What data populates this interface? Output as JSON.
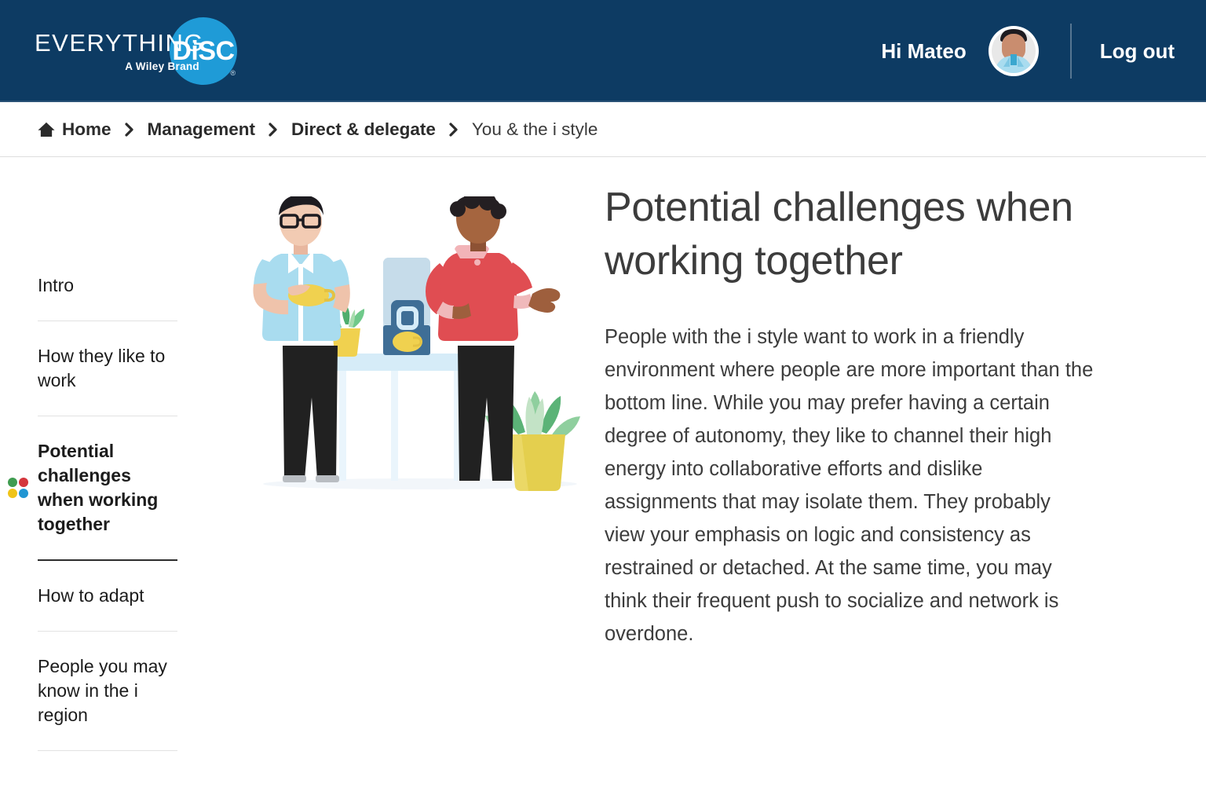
{
  "header": {
    "logo": {
      "wordmark": "EVERYTHING",
      "brand": "A Wiley Brand",
      "disc": "DiSC",
      "registered": "®"
    },
    "greeting": "Hi Mateo",
    "avatar_name": "user-avatar",
    "logout_label": "Log out",
    "background_color": "#0d3b63",
    "accent_color": "#1f9bd7"
  },
  "breadcrumb": {
    "home_label": "Home",
    "separator": "›",
    "items": [
      {
        "label": "Management",
        "current": false
      },
      {
        "label": "Direct & delegate",
        "current": false
      },
      {
        "label": "You & the i style",
        "current": true
      }
    ]
  },
  "sidebar": {
    "items": [
      {
        "label": "Intro",
        "active": false
      },
      {
        "label": "How they like to work",
        "active": false
      },
      {
        "label": "Potential challenges when working together",
        "active": true
      },
      {
        "label": "How to adapt",
        "active": false
      },
      {
        "label": "People you may know in the i region",
        "active": false
      }
    ],
    "active_marker_colors": {
      "top_left": "#3f9c50",
      "top_right": "#d4363c",
      "bottom_left": "#f0c419",
      "bottom_right": "#2196d3"
    }
  },
  "main": {
    "title": "Potential challenges when working together",
    "body": "People with the i style want to work in a friendly environment where people are more important than the bottom line. While you may prefer having a certain degree of autonomy, they like to channel their high energy into collaborative efforts and dislike assignments that may isolate them. They probably view your emphasis on logic and consistency as restrained or detached. At the same time, you may think their frequent push to socialize and network is overdone.",
    "illustration_alt": "Two colleagues chatting by a water cooler table"
  }
}
